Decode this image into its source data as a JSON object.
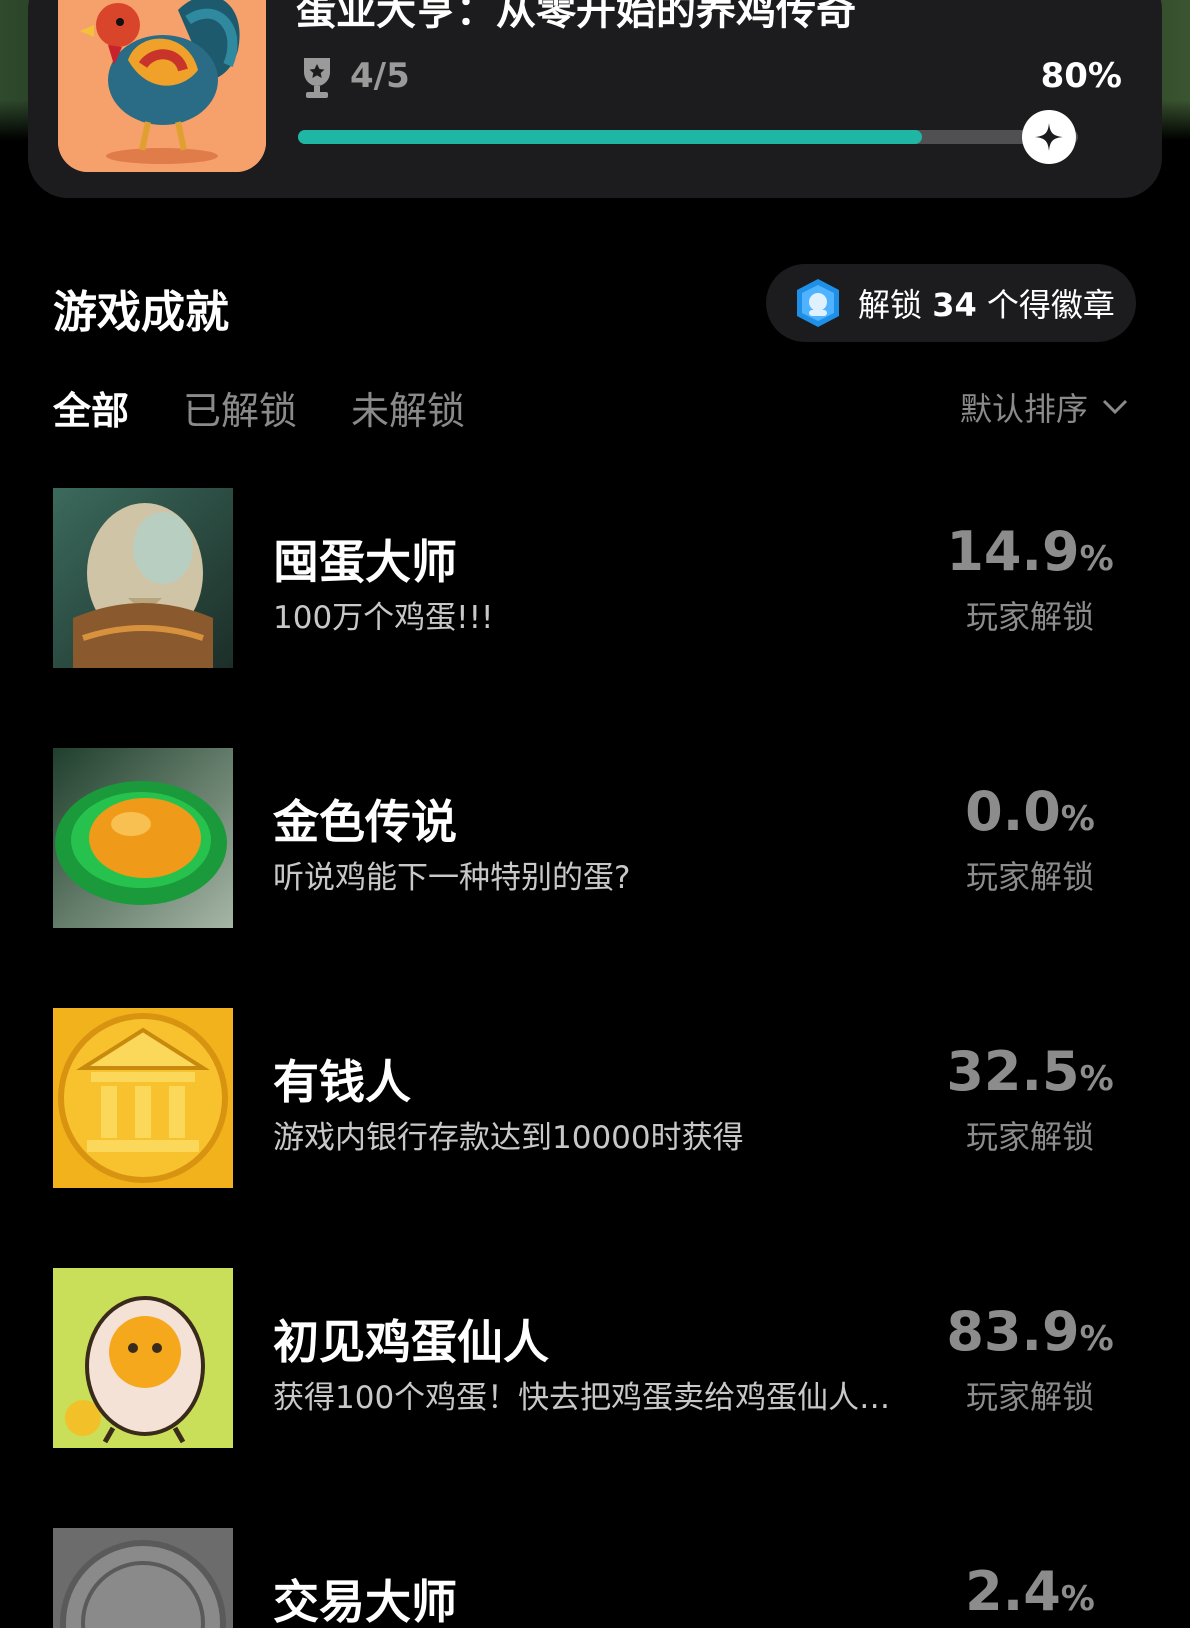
{
  "game": {
    "title": "蛋业大亨：从零开始的养鸡传奇",
    "trophy_count": "4/5",
    "progress_label": "80%",
    "progress_fraction": 0.8
  },
  "achievements_section": {
    "title": "游戏成就",
    "badge_prefix": "解锁",
    "badge_count": "34",
    "badge_suffix": "个得徽章"
  },
  "tabs": [
    {
      "label": "全部",
      "active": true
    },
    {
      "label": "已解锁",
      "active": false
    },
    {
      "label": "未解锁",
      "active": false
    }
  ],
  "sort": {
    "label": "默认排序"
  },
  "achievements": [
    {
      "name": "囤蛋大师",
      "desc": "100万个鸡蛋!!!",
      "pct": "14.9",
      "unit": "%",
      "sub": "玩家解锁",
      "icon": "egg-statue-icon"
    },
    {
      "name": "金色传说",
      "desc": "听说鸡能下一种特别的蛋?",
      "pct": "0.0",
      "unit": "%",
      "sub": "玩家解锁",
      "icon": "golden-egg-icon"
    },
    {
      "name": "有钱人",
      "desc": "游戏内银行存款达到10000时获得",
      "pct": "32.5",
      "unit": "%",
      "sub": "玩家解锁",
      "icon": "bank-coin-icon"
    },
    {
      "name": "初见鸡蛋仙人",
      "desc": "获得100个鸡蛋！快去把鸡蛋卖给鸡蛋仙人…",
      "pct": "83.9",
      "unit": "%",
      "sub": "玩家解锁",
      "icon": "egg-character-icon"
    },
    {
      "name": "交易大师",
      "desc": "",
      "pct": "2.4",
      "unit": "%",
      "sub": "",
      "icon": "silver-coin-icon"
    }
  ],
  "colors": {
    "accent": "#1fb6a4",
    "card": "#1c1c1e",
    "muted": "#8c8c8c"
  }
}
